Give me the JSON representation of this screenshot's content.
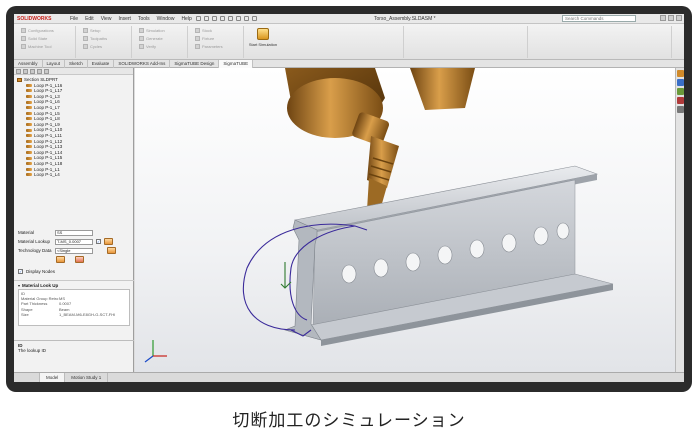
{
  "app": {
    "logo_text": "SOLIDWORKS",
    "menu": [
      "File",
      "Edit",
      "View",
      "Insert",
      "Tools",
      "Window",
      "Help"
    ],
    "document_title": "Torso_Assembly.SLDASM *",
    "search_placeholder": "Search Commands"
  },
  "ribbon": {
    "buttons": [
      [
        "Configurations",
        "Solid State",
        "Machine Tool"
      ],
      [
        "Setup",
        "Toolpaths",
        "Cycles"
      ],
      [
        "Simulation",
        "Generate",
        "Verify"
      ],
      [
        "Stock",
        "Fixture",
        "Parameters"
      ]
    ],
    "start_simulation_label": "Start Simulation"
  },
  "tabs": [
    "Assembly",
    "Layout",
    "Sketch",
    "Evaluate",
    "SOLIDWORKS Add-Ins",
    "SigmaTUBE Design",
    "SigmaTUBE"
  ],
  "active_tab_index": 6,
  "tree": {
    "root": "Section SLDPRT",
    "items": [
      "Loop P-1_L16",
      "Loop P-1_L17",
      "Loop P-1_L3",
      "Loop P-1_L6",
      "Loop P-1_L7",
      "Loop P-1_L5",
      "Loop P-1_L8",
      "Loop P-1_L9",
      "Loop P-1_L10",
      "Loop P-1_L11",
      "Loop P-1_L12",
      "Loop P-1_L13",
      "Loop P-1_L14",
      "Loop P-1_L15",
      "Loop P-1_L18",
      "Loop P-1_L1",
      "Loop P-1_L4"
    ]
  },
  "properties": {
    "material_label": "Material",
    "material_value": "SS",
    "lookup_label": "Material Lookup",
    "lookup_value": "T-MS_0.0007",
    "technology_label": "Technology Data",
    "technology_value": "<Single",
    "display_nodes_label": "Display Nodes"
  },
  "lookup": {
    "title": "Material Look Up",
    "rows": [
      [
        "ID",
        ""
      ],
      [
        "Material Group Retro",
        "MS"
      ],
      [
        "Part Thickness",
        "0.0007"
      ],
      [
        "Shape",
        "Beam"
      ],
      [
        "Size",
        "1_BEAM-M6-E8GH-G-SCT-FHI"
      ]
    ]
  },
  "description": {
    "title": "ID",
    "text": "The lookup ID"
  },
  "bottom_tabs": [
    "Model",
    "Motion Study 1"
  ],
  "caption": "切断加工のシミュレーション",
  "colors": {
    "torch_bronze": "#b5802e",
    "beam_steel": "#c9cdd3",
    "toolpath": "#3a2a9a",
    "caption": "#222222"
  }
}
